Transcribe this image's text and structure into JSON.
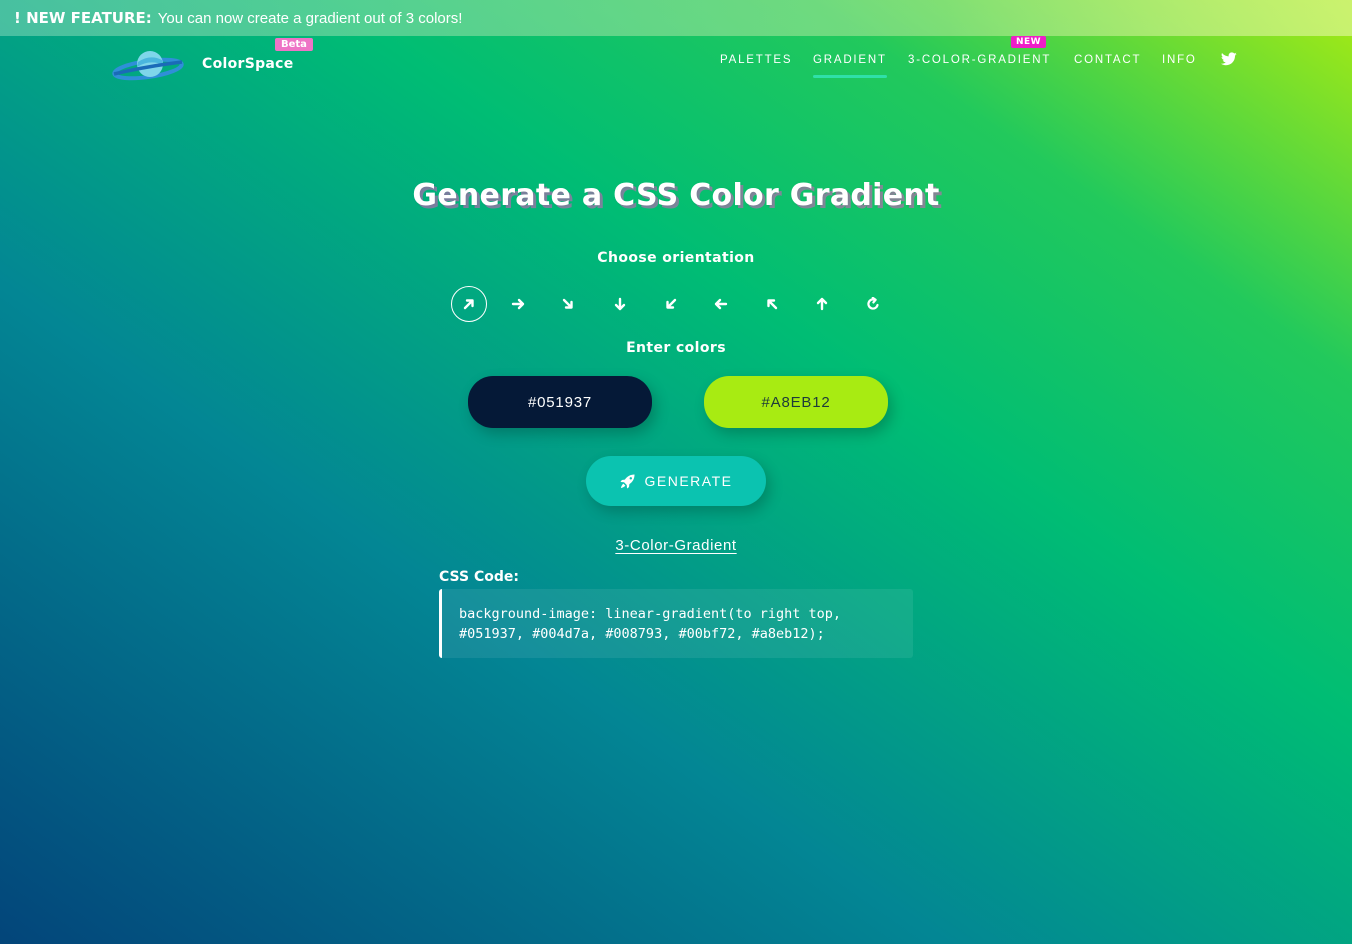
{
  "banner": {
    "prefix": "! NEW FEATURE:",
    "message": "You can now create a gradient out of 3 colors!"
  },
  "header": {
    "brand": "ColorSpace",
    "beta_badge": "Beta",
    "logo_icon": "planet-icon"
  },
  "nav": {
    "items": [
      {
        "label": "PALETTES",
        "active": false
      },
      {
        "label": "GRADIENT",
        "active": true
      },
      {
        "label": "3-COLOR-GRADIENT",
        "active": false
      },
      {
        "label": "CONTACT",
        "active": false
      },
      {
        "label": "INFO",
        "active": false
      }
    ],
    "new_badge": "NEW",
    "social_icon": "twitter-icon"
  },
  "main": {
    "title": "Generate a CSS Color Gradient",
    "orientation_label": "Choose orientation",
    "orientations": [
      {
        "icon": "arrow-up-right-icon",
        "selected": true
      },
      {
        "icon": "arrow-right-icon",
        "selected": false
      },
      {
        "icon": "arrow-down-right-icon",
        "selected": false
      },
      {
        "icon": "arrow-down-icon",
        "selected": false
      },
      {
        "icon": "arrow-down-left-icon",
        "selected": false
      },
      {
        "icon": "arrow-left-icon",
        "selected": false
      },
      {
        "icon": "arrow-up-left-icon",
        "selected": false
      },
      {
        "icon": "arrow-up-icon",
        "selected": false
      },
      {
        "icon": "radial-refresh-icon",
        "selected": false
      }
    ],
    "colors_label": "Enter colors",
    "color1": "#051937",
    "color2": "#A8EB12",
    "generate_label": "GENERATE",
    "generate_icon": "rocket-icon",
    "three_color_link": "3-Color-Gradient",
    "css_label": "CSS Code:",
    "css_code_line1": "background-image: linear-gradient(to right top,",
    "css_code_line2": "#051937, #004d7a, #008793, #00bf72, #a8eb12);"
  },
  "colors": {
    "accent_underline": "#2fe0a8",
    "beta_badge": "#ee74c6",
    "new_badge": "#ee1ec8",
    "generate_button": "#0bc3b0"
  }
}
